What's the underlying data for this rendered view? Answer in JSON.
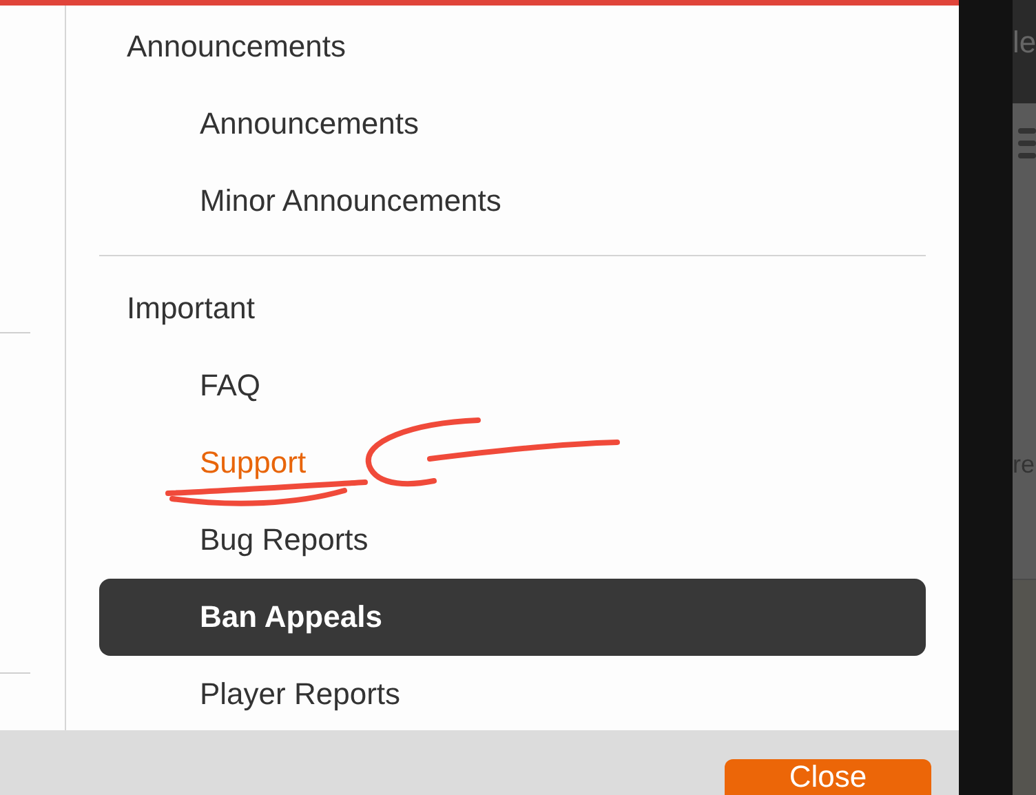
{
  "menu": {
    "groups": [
      {
        "heading": "Announcements",
        "items": [
          {
            "label": "Announcements",
            "selected": false,
            "hovered": false
          },
          {
            "label": "Minor Announcements",
            "selected": false,
            "hovered": false
          }
        ]
      },
      {
        "heading": "Important",
        "items": [
          {
            "label": "FAQ",
            "selected": false,
            "hovered": false
          },
          {
            "label": "Support",
            "selected": false,
            "hovered": true
          },
          {
            "label": "Bug Reports",
            "selected": false,
            "hovered": false
          },
          {
            "label": "Ban Appeals",
            "selected": true,
            "hovered": false
          },
          {
            "label": "Player Reports",
            "selected": false,
            "hovered": false
          }
        ]
      }
    ]
  },
  "footer": {
    "buttons": [
      "Close"
    ]
  },
  "background_page": {
    "texts": [
      "le",
      "re"
    ]
  }
}
